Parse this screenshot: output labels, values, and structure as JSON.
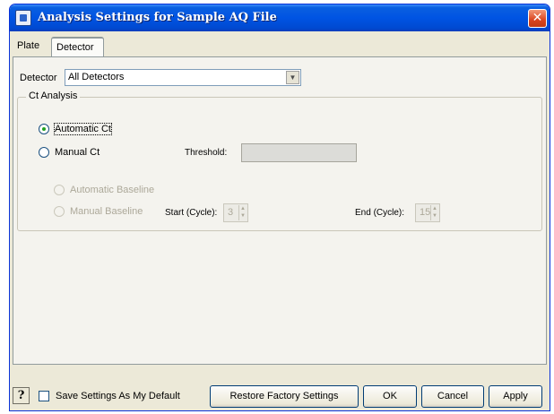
{
  "window": {
    "title": "Analysis Settings for Sample AQ File",
    "close_glyph": "✕",
    "icon": "app-icon"
  },
  "tabs": [
    {
      "label": "Plate",
      "selected": false
    },
    {
      "label": "Detector",
      "selected": true
    }
  ],
  "detector": {
    "label": "Detector",
    "selected_value": "All Detectors"
  },
  "ct_analysis": {
    "group_title": "Ct Analysis",
    "automatic_ct_label": "Automatic Ct",
    "manual_ct_label": "Manual Ct",
    "selected_mode": "automatic",
    "threshold_label": "Threshold:",
    "threshold_value": "",
    "automatic_baseline_label": "Automatic Baseline",
    "manual_baseline_label": "Manual Baseline",
    "start_cycle_label": "Start (Cycle):",
    "start_cycle_value": "3",
    "end_cycle_label": "End (Cycle):",
    "end_cycle_value": "15"
  },
  "footer": {
    "help_label": "?",
    "save_default_label": "Save Settings As My Default",
    "save_default_checked": false,
    "restore_label": "Restore Factory Settings",
    "ok_label": "OK",
    "cancel_label": "Cancel",
    "apply_label": "Apply"
  },
  "colors": {
    "titlebar": "#0054e3",
    "window_bg": "#ece9d8",
    "close_button": "#d9441e",
    "disabled_text": "#aca899"
  }
}
